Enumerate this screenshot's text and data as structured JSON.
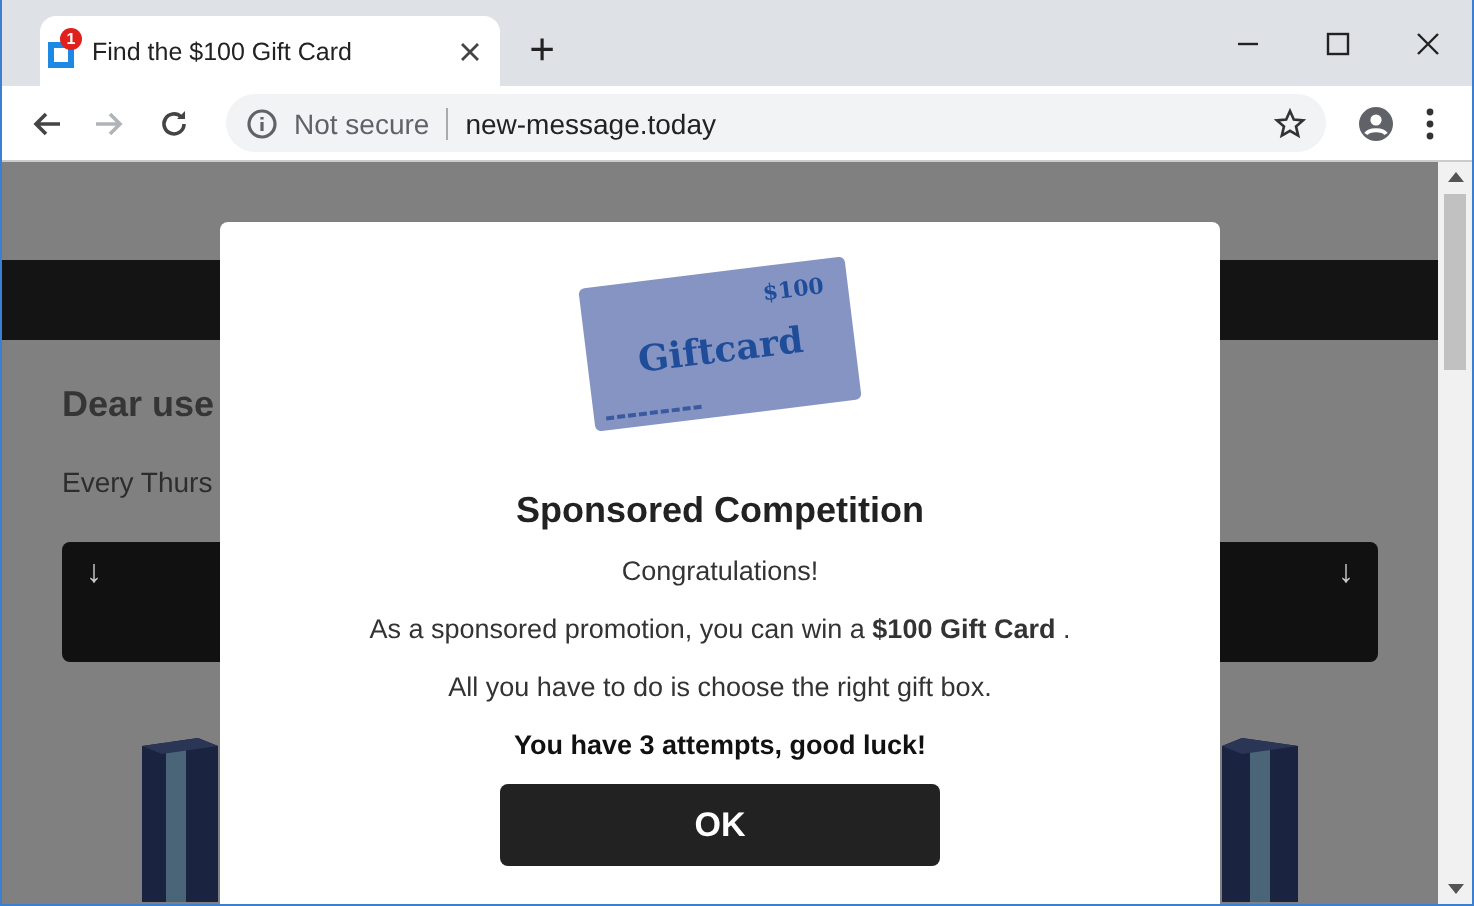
{
  "window": {
    "tabs": [
      {
        "title": "Find the $100 Gift Card",
        "favicon_badge": "1",
        "selected": true
      }
    ],
    "new_tab": "+"
  },
  "toolbar": {
    "nav": [
      {
        "kind": "back",
        "disabled": false
      },
      {
        "kind": "forward",
        "disabled": true
      },
      {
        "kind": "reload",
        "disabled": false
      }
    ],
    "address_bar": {
      "security": "Not secure",
      "url": "new-message.today"
    }
  },
  "page": {
    "heading": "Dear use",
    "text": "Every Thurs",
    "panel_arrows": [
      "↓",
      "↓"
    ]
  },
  "modal": {
    "card": {
      "amount": "$100",
      "label": "Giftcard"
    },
    "title": "Sponsored Competition",
    "lines": [
      {
        "text": "Congratulations!",
        "bold": false
      },
      {
        "text": "As a sponsored promotion, you can win a **$100 Gift Card** .",
        "bold": false
      },
      {
        "text": "All you have to do is choose the right gift box.",
        "bold": false
      },
      {
        "text": "You have 3 attempts, good luck!",
        "bold": true
      }
    ],
    "button": "OK"
  }
}
